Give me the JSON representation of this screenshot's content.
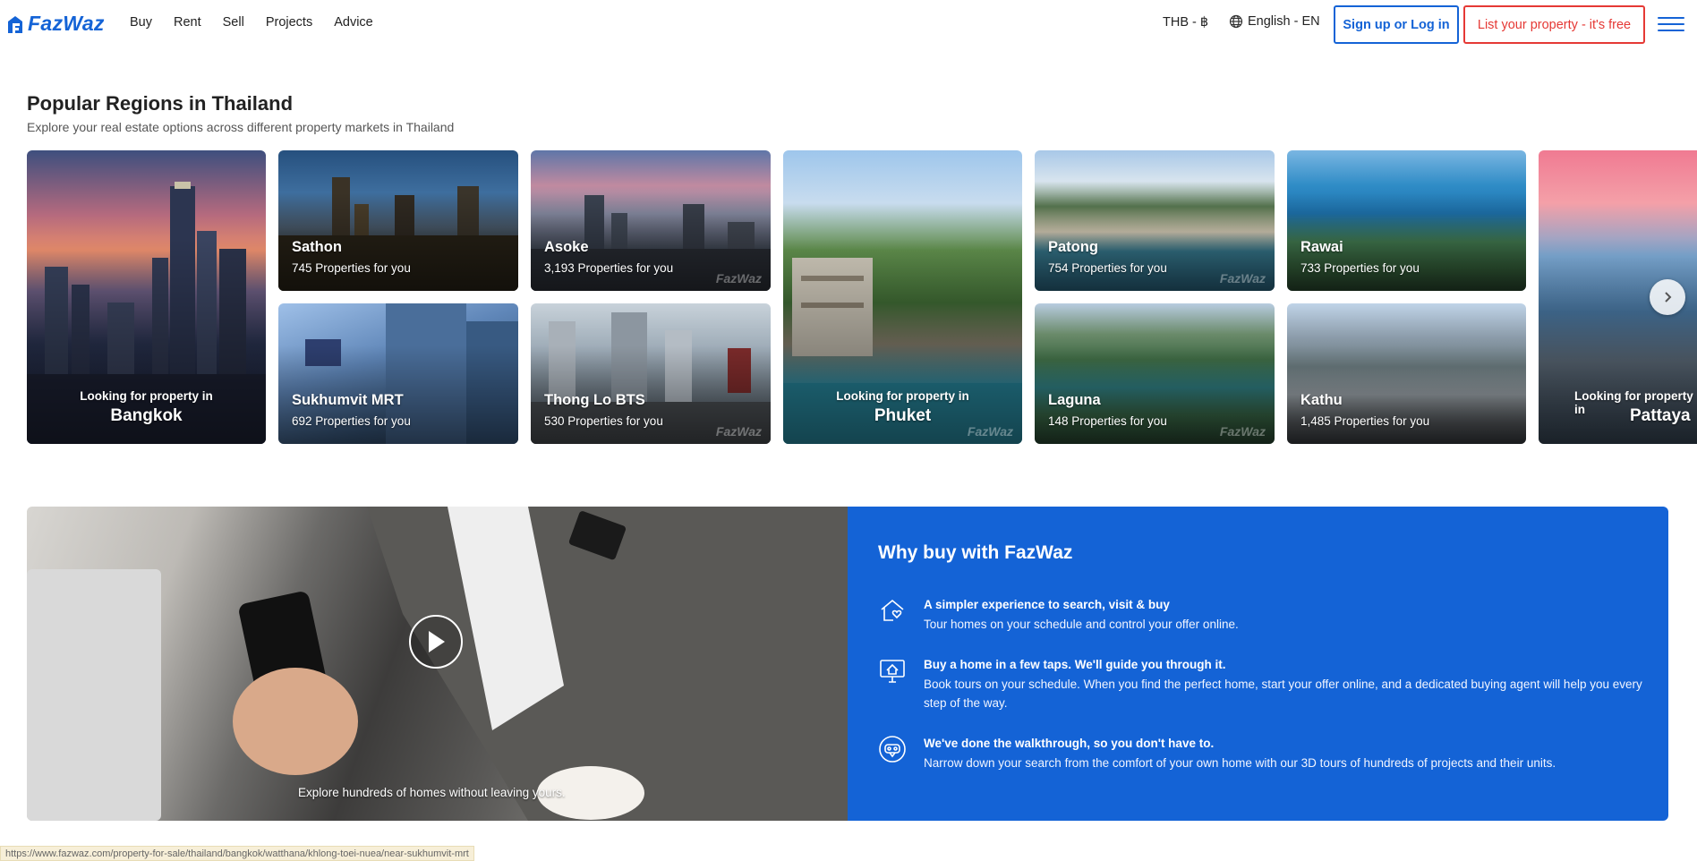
{
  "header": {
    "logo_text": "FazWaz",
    "nav": [
      "Buy",
      "Rent",
      "Sell",
      "Projects",
      "Advice"
    ],
    "currency": "THB - ฿",
    "language": "English - EN",
    "login_label": "Sign up or Log in",
    "list_label": "List your property - it's free"
  },
  "regions": {
    "title": "Popular Regions in Thailand",
    "subtitle": "Explore your real estate options across different property markets in Thailand",
    "looking_label": "Looking for property in",
    "watermark": "FazWaz",
    "big_cards": [
      {
        "city": "Bangkok"
      },
      {
        "city": "Phuket"
      },
      {
        "city": "Pattaya"
      }
    ],
    "small_cards": [
      {
        "name": "Sathon",
        "count": "745 Properties for you"
      },
      {
        "name": "Sukhumvit MRT",
        "count": "692 Properties for you"
      },
      {
        "name": "Asoke",
        "count": "3,193 Properties for you"
      },
      {
        "name": "Thong Lo BTS",
        "count": "530 Properties for you"
      },
      {
        "name": "Patong",
        "count": "754 Properties for you"
      },
      {
        "name": "Laguna",
        "count": "148 Properties for you"
      },
      {
        "name": "Rawai",
        "count": "733 Properties for you"
      },
      {
        "name": "Kathu",
        "count": "1,485 Properties for you"
      }
    ]
  },
  "video": {
    "caption": "Explore hundreds of homes without leaving yours."
  },
  "why": {
    "title": "Why buy with FazWaz",
    "items": [
      {
        "icon": "house-heart-icon",
        "title": "A simpler experience to search, visit & buy",
        "desc": "Tour homes on your schedule and control your offer online."
      },
      {
        "icon": "monitor-house-icon",
        "title": "Buy a home in a few taps. We'll guide you through it.",
        "desc": "Book tours on your schedule. When you find the perfect home, start your offer online, and a dedicated buying agent will help you every step of the way."
      },
      {
        "icon": "vr-headset-icon",
        "title": "We've done the walkthrough, so you don't have to.",
        "desc": "Narrow down your search from the comfort of your own home with our 3D tours of hundreds of projects and their units."
      }
    ]
  },
  "status_url": "https://www.fazwaz.com/property-for-sale/thailand/bangkok/watthana/khlong-toei-nuea/near-sukhumvit-mrt",
  "colors": {
    "brand": "#1463d6",
    "accent_red": "#e53935"
  }
}
